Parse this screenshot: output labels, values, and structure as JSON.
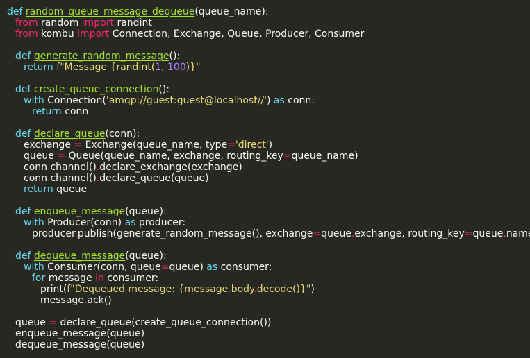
{
  "code": {
    "l01": [
      "def ",
      "random_queue_message_dequeue",
      "(queue_name):"
    ],
    "l02": [
      "from ",
      "random ",
      "import ",
      "randint"
    ],
    "l03": [
      "from ",
      "kombu ",
      "import ",
      "Connection, Exchange, Queue, Producer, Consumer"
    ],
    "l04": [
      "def ",
      "generate_random_message",
      "():"
    ],
    "l05": [
      "return ",
      "f\"Message {randint(",
      "1",
      ", ",
      "100",
      ")}\""
    ],
    "l06": [
      "def ",
      "create_queue_connection",
      "():"
    ],
    "l07": [
      "with ",
      "Connection(",
      "'amqp://guest:guest@localhost//'",
      ") ",
      "as ",
      "conn:"
    ],
    "l08": [
      "return ",
      "conn"
    ],
    "l09": [
      "def ",
      "declare_queue",
      "(conn):"
    ],
    "l10": [
      "exchange ",
      "= ",
      "Exchange(queue_name, type",
      "=",
      "'direct'",
      ")"
    ],
    "l11": [
      "queue ",
      "= ",
      "Queue(queue_name, exchange, routing_key",
      "=",
      "queue_name)"
    ],
    "l12": [
      "conn",
      ".",
      "channel()",
      ".",
      "declare_exchange(exchange)"
    ],
    "l13": [
      "conn",
      ".",
      "channel()",
      ".",
      "declare_queue(queue)"
    ],
    "l14": [
      "return ",
      "queue"
    ],
    "l15": [
      "def ",
      "enqueue_message",
      "(queue):"
    ],
    "l16": [
      "with ",
      "Producer(conn) ",
      "as ",
      "producer:"
    ],
    "l17": [
      "producer",
      ".",
      "publish(generate_random_message(), exchange",
      "=",
      "queue",
      ".",
      "exchange, routing_key",
      "=",
      "queue",
      ".",
      "name)"
    ],
    "l18": [
      "def ",
      "dequeue_message",
      "(queue):"
    ],
    "l19": [
      "with ",
      "Consumer(conn, queue",
      "=",
      "queue) ",
      "as ",
      "consumer:"
    ],
    "l20": [
      "for ",
      "message ",
      "in ",
      "consumer:"
    ],
    "l21": [
      "print(",
      "f\"Dequeued message: {message",
      ".",
      "body",
      ".",
      "decode()}\"",
      ")"
    ],
    "l22": [
      "message",
      ".",
      "ack()"
    ],
    "l23": [
      "queue ",
      "= ",
      "declare_queue(create_queue_connection())"
    ],
    "l24": [
      "enqueue_message(queue)"
    ],
    "l25": [
      "dequeue_message(queue)"
    ]
  }
}
